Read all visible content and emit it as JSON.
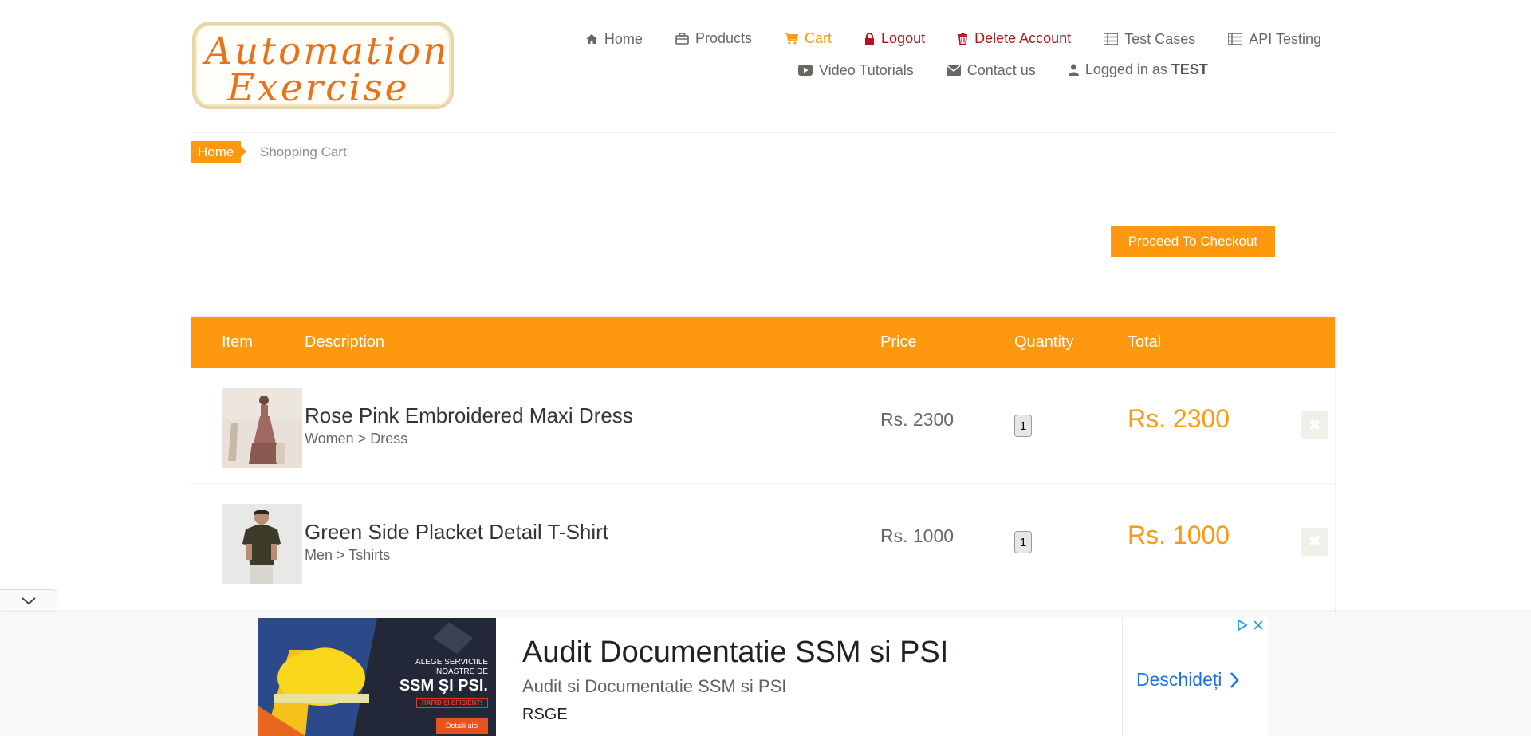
{
  "logo": {
    "line1": "Automation",
    "line2": "Exercise"
  },
  "nav": {
    "home": "Home",
    "products": "Products",
    "cart": "Cart",
    "logout": "Logout",
    "delete_account": "Delete Account",
    "test_cases": "Test Cases",
    "api_testing": "API Testing",
    "video_tutorials": "Video Tutorials",
    "contact_us": "Contact us",
    "logged_in_prefix": "Logged in as",
    "username": "TEST"
  },
  "breadcrumb": {
    "home": "Home",
    "current": "Shopping Cart"
  },
  "checkout_button": "Proceed To Checkout",
  "cart": {
    "headers": {
      "item": "Item",
      "description": "Description",
      "price": "Price",
      "quantity": "Quantity",
      "total": "Total"
    },
    "items": [
      {
        "name": "Rose Pink Embroidered Maxi Dress",
        "category": "Women > Dress",
        "price": "Rs. 2300",
        "quantity": "1",
        "total": "Rs. 2300",
        "delete_icon": "x-icon"
      },
      {
        "name": "Green Side Placket Detail T-Shirt",
        "category": "Men > Tshirts",
        "price": "Rs. 1000",
        "quantity": "1",
        "total": "Rs. 1000",
        "delete_icon": "x-icon"
      }
    ]
  },
  "ad": {
    "image_lines": [
      "ALEGE SERVICIILE",
      "NOASTRE DE"
    ],
    "image_big": "SSM ŞI PSI.",
    "image_tag": "RAPID ŞI EFICIENT!",
    "image_button": "Detalii aici",
    "title": "Audit Documentatie SSM si PSI",
    "subtitle": "Audit si Documentatie SSM si PSI",
    "brand": "RSGE",
    "cta": "Deschideți"
  },
  "colors": {
    "accent": "#fe980f",
    "danger": "#b0151b",
    "text": "#696763",
    "link": "#1a73e8"
  }
}
